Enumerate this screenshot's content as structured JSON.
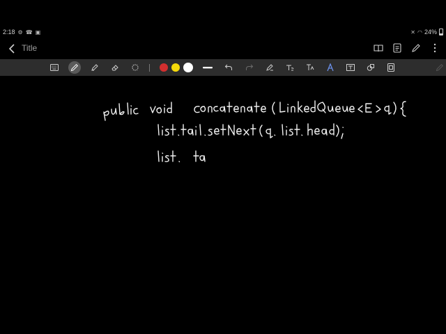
{
  "status_bar": {
    "time": "2:18",
    "battery": "24%"
  },
  "app_bar": {
    "title": "Title",
    "actions": [
      "book-icon",
      "list-icon",
      "pen-icon",
      "more-icon"
    ]
  },
  "toolbar": {
    "tools": [
      "keyboard-icon",
      "pen-icon",
      "highlighter-icon",
      "eraser-icon",
      "lasso-icon",
      "stroke-width-icon",
      "undo-icon",
      "redo-icon",
      "shape-pen-icon",
      "text-convert-icon",
      "text-box-icon",
      "fill-icon",
      "insert-text-icon",
      "shapes-icon",
      "image-icon",
      "pencil-icon"
    ],
    "colors": [
      "#d32f2f",
      "#f5d90a",
      "#ffffff"
    ],
    "selected_color": "#ffffff",
    "active_tool": "pen-icon"
  },
  "note": {
    "lines": [
      "public void concatenate (LinkedQueue <E> q) {",
      "list.tail.setNext (q.list.head);",
      "list.ta"
    ]
  }
}
